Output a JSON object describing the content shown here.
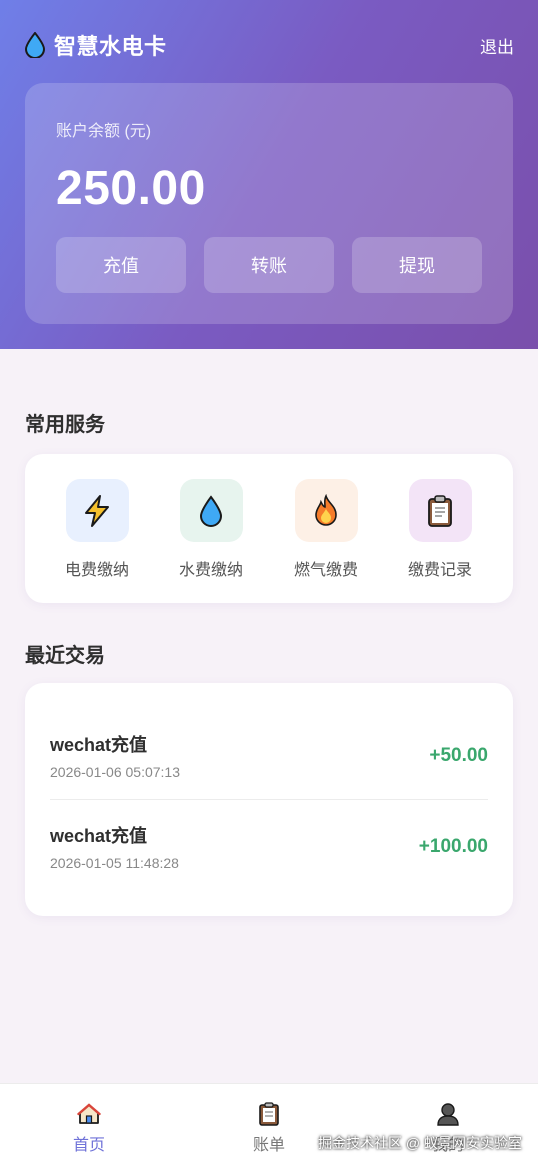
{
  "header": {
    "app_title": "智慧水电卡",
    "logout_label": "退出",
    "brand_icon": "water-drop-icon"
  },
  "balance": {
    "label": "账户余额 (元)",
    "amount": "250.00",
    "actions": [
      {
        "label": "充值"
      },
      {
        "label": "转账"
      },
      {
        "label": "提现"
      }
    ]
  },
  "services": {
    "title": "常用服务",
    "items": [
      {
        "label": "电费缴纳",
        "icon": "lightning-icon",
        "bg": "#e8f0fe"
      },
      {
        "label": "水费缴纳",
        "icon": "water-drop-icon",
        "bg": "#e7f4ee"
      },
      {
        "label": "燃气缴费",
        "icon": "flame-icon",
        "bg": "#fdf0e6"
      },
      {
        "label": "缴费记录",
        "icon": "clipboard-icon",
        "bg": "#f3e4f7"
      }
    ]
  },
  "transactions": {
    "title": "最近交易",
    "items": [
      {
        "title": "wechat充值",
        "time": "2026-01-06 05:07:13",
        "amount": "+50.00"
      },
      {
        "title": "wechat充值",
        "time": "2026-01-05 11:48:28",
        "amount": "+100.00"
      }
    ]
  },
  "bottom_nav": {
    "items": [
      {
        "label": "首页",
        "icon": "home-icon",
        "active": true
      },
      {
        "label": "账单",
        "icon": "clipboard-icon",
        "active": false
      },
      {
        "label": "我的",
        "icon": "user-icon",
        "active": false
      }
    ]
  },
  "watermark": "掘金技术社区 @ 蚁景网安实验室",
  "colors": {
    "accent": "#6f72d8",
    "positive": "#3aa76d",
    "gradient_start": "#6f7fe8",
    "gradient_end": "#7a4fab"
  }
}
